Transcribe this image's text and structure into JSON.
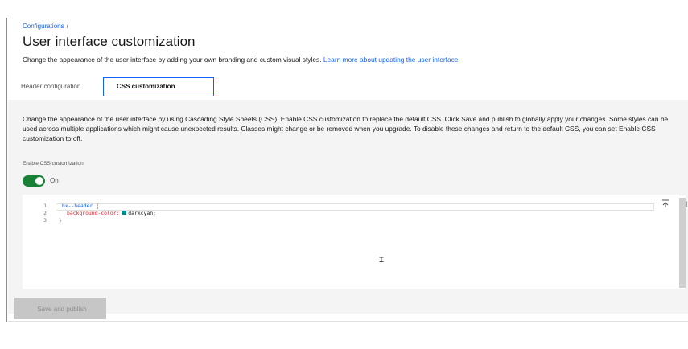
{
  "breadcrumb": {
    "link": "Configurations",
    "separator": "/"
  },
  "page": {
    "title": "User interface customization",
    "description": "Change the appearance of the user interface by adding your own branding and custom visual styles. ",
    "learn_more": "Learn more about updating the user interface"
  },
  "tabs": [
    {
      "label": "Header configuration",
      "selected": false
    },
    {
      "label": "CSS customization",
      "selected": true
    }
  ],
  "panel": {
    "description": "Change the appearance of the user interface by using Cascading Style Sheets (CSS). Enable CSS customization to replace the default CSS. Click Save and publish to globally apply your changes. Some styles can be used across multiple applications which might cause unexpected results. Classes might change or be removed when you upgrade. To disable these changes and return to the default CSS, you can set Enable CSS customization to off.",
    "toggle_label": "Enable CSS customization",
    "toggle_state": "On"
  },
  "editor": {
    "lines": [
      {
        "number": "1",
        "selector": ".bx--header",
        "brace": "{"
      },
      {
        "number": "2",
        "property": "background-color:",
        "value": "darkcyan;"
      },
      {
        "number": "3",
        "brace": "}"
      }
    ],
    "swatch_color": "#008b8b"
  },
  "actions": {
    "save_label": "Save and publish"
  },
  "colors": {
    "link": "#0f62fe",
    "toggle_on": "#198038",
    "tab_border": "#0f62fe"
  }
}
